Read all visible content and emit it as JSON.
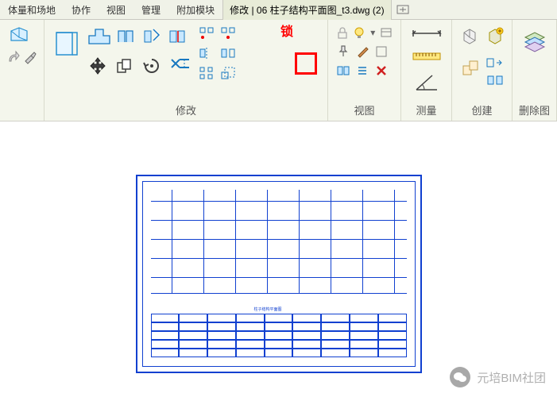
{
  "tabs": {
    "menu": [
      "体量和场地",
      "协作",
      "视图",
      "管理",
      "附加模块"
    ],
    "active": "修改",
    "doc": "06 柱子结构平面图_t3.dwg (2)"
  },
  "panels": {
    "modify": "修改",
    "view": "视图",
    "measure": "测量",
    "create": "创建",
    "delete": "删除图"
  },
  "lock_label": "锁",
  "drawing": {
    "title": "柱子结构平面图"
  },
  "watermark": "元培BIM社团"
}
